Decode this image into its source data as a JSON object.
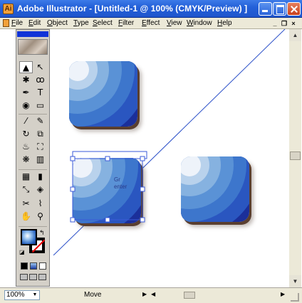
{
  "window": {
    "title": "Adobe Illustrator - [Untitled-1 @ 100% (CMYK/Preview) ]",
    "app_icon": "Ai",
    "minimize_icon": "minimize-icon",
    "maximize_icon": "maximize-icon",
    "close_icon": "close-icon"
  },
  "menu": {
    "items": [
      "File",
      "Edit",
      "Object",
      "Type",
      "Select",
      "Filter",
      "Effect",
      "View",
      "Window",
      "Help"
    ],
    "doc_minimize": "_",
    "doc_restore": "❐",
    "doc_close": "×"
  },
  "toolbox": {
    "tools": [
      {
        "name": "selection-tool-icon",
        "glyph": "▲"
      },
      {
        "name": "direct-selection-tool-icon",
        "glyph": "↖"
      },
      {
        "name": "magic-wand-tool-icon",
        "glyph": "✱"
      },
      {
        "name": "lasso-tool-icon",
        "glyph": "ꝏ"
      },
      {
        "name": "pen-tool-icon",
        "glyph": "✒"
      },
      {
        "name": "type-tool-icon",
        "glyph": "T"
      },
      {
        "name": "ellipse-tool-icon",
        "glyph": "◉"
      },
      {
        "name": "rectangle-tool-icon",
        "glyph": "▭"
      },
      {
        "name": "paintbrush-tool-icon",
        "glyph": "⁄"
      },
      {
        "name": "pencil-tool-icon",
        "glyph": "✎"
      },
      {
        "name": "rotate-tool-icon",
        "glyph": "↻"
      },
      {
        "name": "scale-tool-icon",
        "glyph": "⧉"
      },
      {
        "name": "warp-tool-icon",
        "glyph": "♨"
      },
      {
        "name": "free-transform-tool-icon",
        "glyph": "⛶"
      },
      {
        "name": "symbol-sprayer-tool-icon",
        "glyph": "❋"
      },
      {
        "name": "column-graph-tool-icon",
        "glyph": "▥"
      },
      {
        "name": "mesh-tool-icon",
        "glyph": "▦"
      },
      {
        "name": "gradient-tool-icon",
        "glyph": "▮"
      },
      {
        "name": "eyedropper-tool-icon",
        "glyph": "⤡"
      },
      {
        "name": "blend-tool-icon",
        "glyph": "◈"
      },
      {
        "name": "scissors-tool-icon",
        "glyph": "✂"
      },
      {
        "name": "knife-tool-icon",
        "glyph": "⌇"
      },
      {
        "name": "hand-tool-icon",
        "glyph": "✋"
      },
      {
        "name": "zoom-tool-icon",
        "glyph": "⚲"
      }
    ],
    "swap_glyph": "↰",
    "default_glyph": "◪"
  },
  "canvas": {
    "tile_colors": [
      "#1b2f9a",
      "#2a56c0",
      "#3d76cc",
      "#5a92d6",
      "#86b2e0",
      "#b9d2ec",
      "#eef3fa"
    ],
    "selection_label_1": "Gr",
    "selection_label_2": "enter"
  },
  "status": {
    "zoom": "100%",
    "tool_status": "Move",
    "left_arrow": "◀",
    "right_arrow": "▶",
    "zoom_arrow": "▼"
  },
  "scrollbar": {
    "up_arrow": "▲",
    "down_arrow": "▼"
  }
}
